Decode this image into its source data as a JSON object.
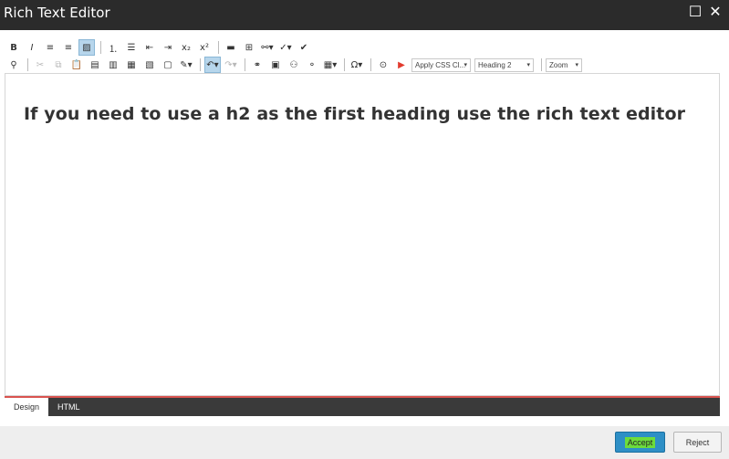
{
  "window": {
    "title": "Rich Text Editor",
    "maximize_glyph": "☐",
    "close_glyph": "✕"
  },
  "toolbar_row1": [
    {
      "name": "bold-button",
      "glyph": "B",
      "style": "bold"
    },
    {
      "name": "italic-button",
      "glyph": "I",
      "style": "italic"
    },
    {
      "name": "align-left-button",
      "glyph": "≡"
    },
    {
      "name": "align-center-button",
      "glyph": "≡"
    },
    {
      "name": "justify-button",
      "glyph": "▨",
      "active": true
    },
    {
      "sep": true
    },
    {
      "name": "numbered-list-button",
      "glyph": "⒈"
    },
    {
      "name": "bullet-list-button",
      "glyph": "☰"
    },
    {
      "name": "outdent-button",
      "glyph": "⇤"
    },
    {
      "name": "indent-button",
      "glyph": "⇥"
    },
    {
      "name": "subscript-button",
      "glyph": "x₂"
    },
    {
      "name": "superscript-button",
      "glyph": "x²"
    },
    {
      "sep": true
    },
    {
      "name": "horizontal-rule-button",
      "glyph": "▬"
    },
    {
      "name": "insert-snippet-button",
      "glyph": "⊞"
    },
    {
      "name": "link-dropdown-button",
      "glyph": "⚯▾"
    },
    {
      "name": "spell-check-dropdown-button",
      "glyph": "✓▾"
    },
    {
      "name": "check-button",
      "glyph": "✔"
    }
  ],
  "toolbar_row2": [
    {
      "name": "find-button",
      "glyph": "⚲"
    },
    {
      "sep": true
    },
    {
      "name": "cut-button",
      "glyph": "✂",
      "disabled": true
    },
    {
      "name": "copy-button",
      "glyph": "⧉",
      "disabled": true
    },
    {
      "name": "paste-button",
      "glyph": "📋"
    },
    {
      "name": "paste-plain-button",
      "glyph": "▤"
    },
    {
      "name": "paste-word-button",
      "glyph": "▥"
    },
    {
      "name": "paste-html-button",
      "glyph": "▦"
    },
    {
      "name": "paste-markdown-button",
      "glyph": "▧"
    },
    {
      "name": "paste-as-text-button",
      "glyph": "▢"
    },
    {
      "name": "format-stripper-dropdown-button",
      "glyph": "✎▾"
    },
    {
      "sep": true
    },
    {
      "name": "undo-button",
      "glyph": "↶▾",
      "active": true
    },
    {
      "name": "redo-button",
      "glyph": "↷▾",
      "disabled": true
    },
    {
      "sep": true
    },
    {
      "name": "insert-link-button",
      "glyph": "⚭"
    },
    {
      "name": "insert-image-button",
      "glyph": "▣"
    },
    {
      "name": "insert-media-button",
      "glyph": "⚇"
    },
    {
      "name": "remove-link-button",
      "glyph": "⚬"
    },
    {
      "name": "table-dropdown-button",
      "glyph": "▦▾"
    },
    {
      "sep": true
    },
    {
      "name": "symbol-dropdown-button",
      "glyph": "Ω▾"
    },
    {
      "sep": true
    },
    {
      "name": "play-button",
      "glyph": "⊙"
    },
    {
      "name": "run-button",
      "glyph": "▶",
      "color": "#e23b2e"
    }
  ],
  "dropdowns": {
    "css_class": "Apply CSS Cl...",
    "format": "Heading 2",
    "zoom": "Zoom"
  },
  "editor": {
    "heading_text": "If you need to use a h2 as the first heading use the rich text editor"
  },
  "modes": {
    "design": "Design",
    "html": "HTML"
  },
  "footer": {
    "accept": "Accept",
    "reject": "Reject"
  },
  "colors": {
    "titlebar": "#2b2b2b",
    "accept": "#2e8fc6",
    "mode_border": "#d9534f"
  }
}
